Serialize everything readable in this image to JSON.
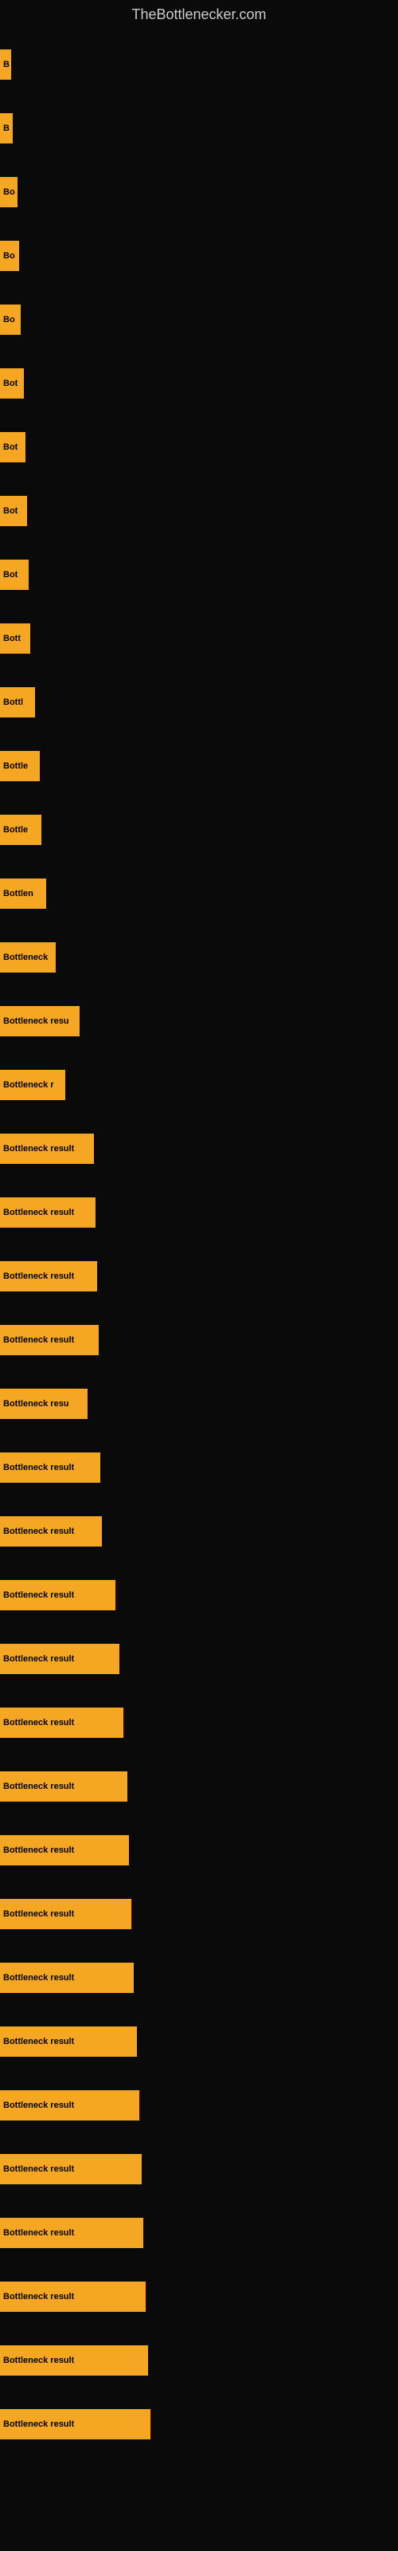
{
  "site_title": "TheBottlenecker.com",
  "bars": [
    {
      "label": "B",
      "width": 14
    },
    {
      "label": "B",
      "width": 16
    },
    {
      "label": "Bo",
      "width": 22
    },
    {
      "label": "Bo",
      "width": 24
    },
    {
      "label": "Bo",
      "width": 26
    },
    {
      "label": "Bot",
      "width": 30
    },
    {
      "label": "Bot",
      "width": 32
    },
    {
      "label": "Bot",
      "width": 34
    },
    {
      "label": "Bot",
      "width": 36
    },
    {
      "label": "Bott",
      "width": 38
    },
    {
      "label": "Bottl",
      "width": 44
    },
    {
      "label": "Bottle",
      "width": 50
    },
    {
      "label": "Bottle",
      "width": 52
    },
    {
      "label": "Bottlen",
      "width": 58
    },
    {
      "label": "Bottleneck",
      "width": 70
    },
    {
      "label": "Bottleneck resu",
      "width": 100
    },
    {
      "label": "Bottleneck r",
      "width": 82
    },
    {
      "label": "Bottleneck result",
      "width": 118
    },
    {
      "label": "Bottleneck result",
      "width": 120
    },
    {
      "label": "Bottleneck result",
      "width": 122
    },
    {
      "label": "Bottleneck result",
      "width": 124
    },
    {
      "label": "Bottleneck resu",
      "width": 110
    },
    {
      "label": "Bottleneck result",
      "width": 126
    },
    {
      "label": "Bottleneck result",
      "width": 128
    },
    {
      "label": "Bottleneck result",
      "width": 145
    },
    {
      "label": "Bottleneck result",
      "width": 150
    },
    {
      "label": "Bottleneck result",
      "width": 155
    },
    {
      "label": "Bottleneck result",
      "width": 160
    },
    {
      "label": "Bottleneck result",
      "width": 162
    },
    {
      "label": "Bottleneck result",
      "width": 165
    },
    {
      "label": "Bottleneck result",
      "width": 168
    },
    {
      "label": "Bottleneck result",
      "width": 172
    },
    {
      "label": "Bottleneck result",
      "width": 175
    },
    {
      "label": "Bottleneck result",
      "width": 178
    },
    {
      "label": "Bottleneck result",
      "width": 180
    },
    {
      "label": "Bottleneck result",
      "width": 183
    },
    {
      "label": "Bottleneck result",
      "width": 186
    },
    {
      "label": "Bottleneck result",
      "width": 189
    }
  ]
}
